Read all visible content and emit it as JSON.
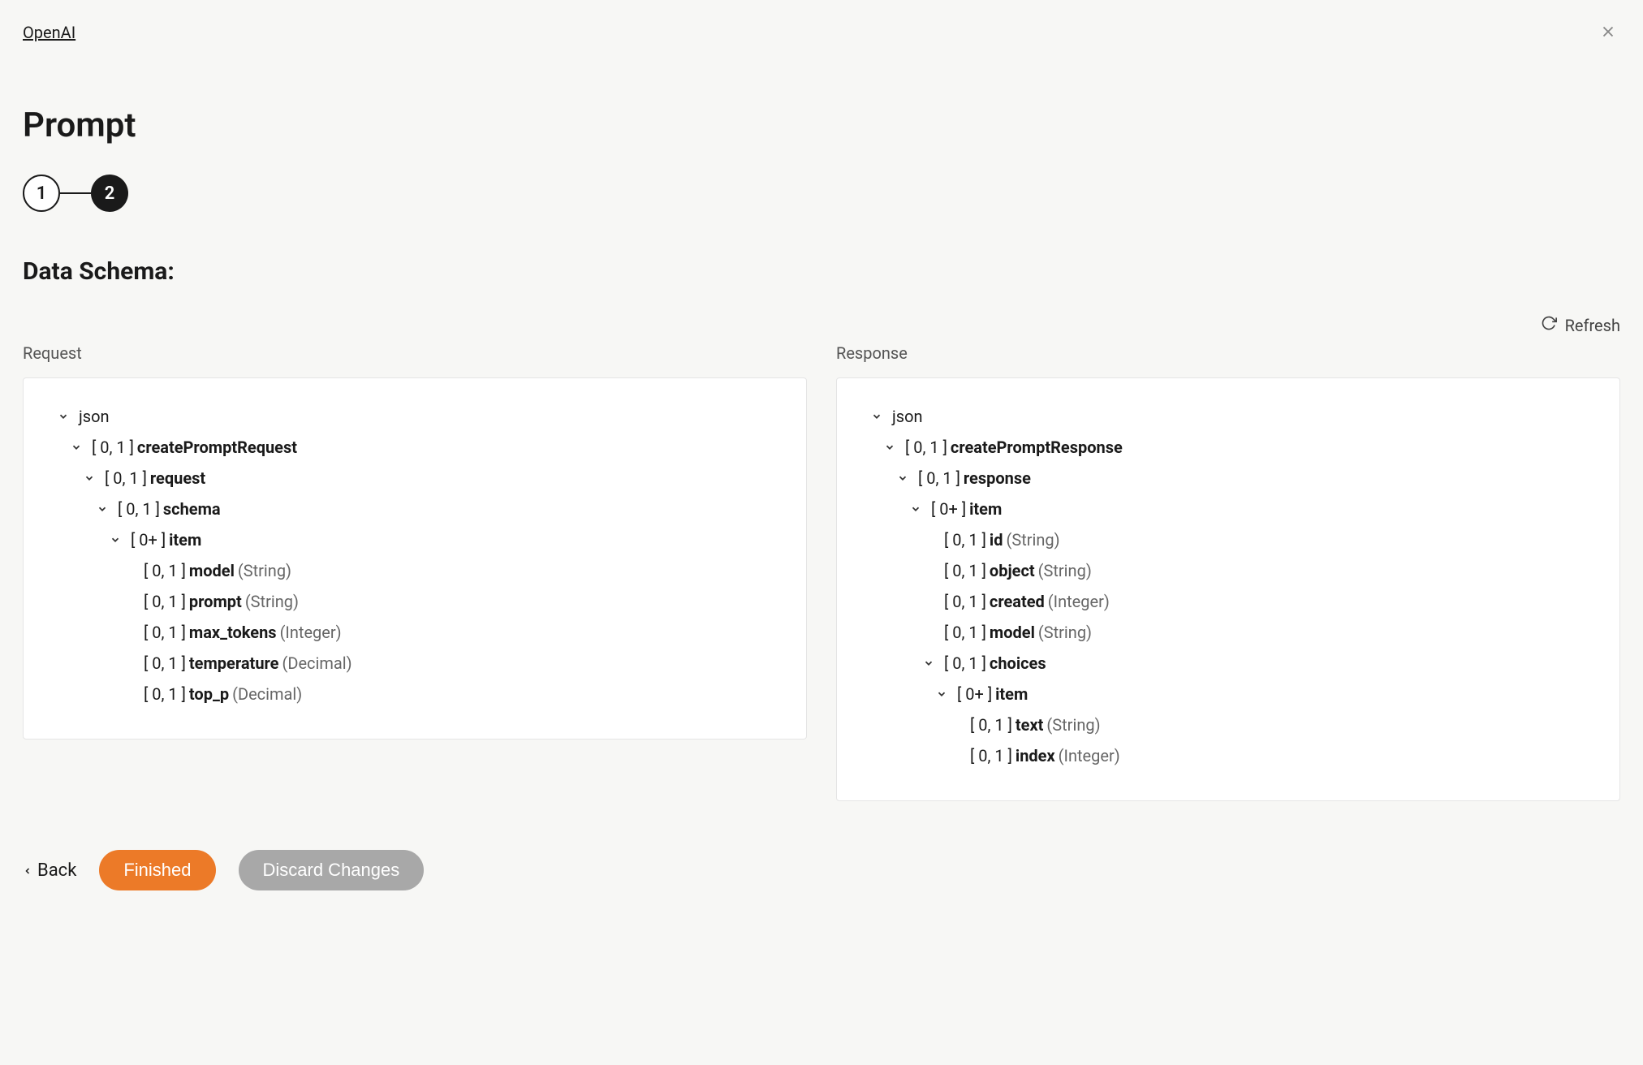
{
  "header": {
    "link": "OpenAI",
    "title": "Prompt"
  },
  "stepper": {
    "step1": "1",
    "step2": "2"
  },
  "schema": {
    "title": "Data Schema:",
    "refresh": "Refresh"
  },
  "columns": {
    "request": {
      "header": "Request",
      "root": "json",
      "nodes": {
        "n0": {
          "card": "[ 0, 1 ] ",
          "name": "createPromptRequest"
        },
        "n1": {
          "card": "[ 0, 1 ] ",
          "name": "request"
        },
        "n2": {
          "card": "[ 0, 1 ] ",
          "name": "schema"
        },
        "n3": {
          "card": "[ 0+ ] ",
          "name": "item"
        },
        "n4": {
          "card": "[ 0, 1 ] ",
          "name": "model",
          "type": " (String)"
        },
        "n5": {
          "card": "[ 0, 1 ] ",
          "name": "prompt",
          "type": " (String)"
        },
        "n6": {
          "card": "[ 0, 1 ] ",
          "name": "max_tokens",
          "type": " (Integer)"
        },
        "n7": {
          "card": "[ 0, 1 ] ",
          "name": "temperature",
          "type": " (Decimal)"
        },
        "n8": {
          "card": "[ 0, 1 ] ",
          "name": "top_p",
          "type": " (Decimal)"
        }
      }
    },
    "response": {
      "header": "Response",
      "root": "json",
      "nodes": {
        "n0": {
          "card": "[ 0, 1 ] ",
          "name": "createPromptResponse"
        },
        "n1": {
          "card": "[ 0, 1 ] ",
          "name": "response"
        },
        "n2": {
          "card": "[ 0+ ] ",
          "name": "item"
        },
        "n3": {
          "card": "[ 0, 1 ] ",
          "name": "id",
          "type": " (String)"
        },
        "n4": {
          "card": "[ 0, 1 ] ",
          "name": "object",
          "type": " (String)"
        },
        "n5": {
          "card": "[ 0, 1 ] ",
          "name": "created",
          "type": " (Integer)"
        },
        "n6": {
          "card": "[ 0, 1 ] ",
          "name": "model",
          "type": " (String)"
        },
        "n7": {
          "card": "[ 0, 1 ] ",
          "name": "choices"
        },
        "n8": {
          "card": "[ 0+ ] ",
          "name": "item"
        },
        "n9": {
          "card": "[ 0, 1 ] ",
          "name": "text",
          "type": " (String)"
        },
        "n10": {
          "card": "[ 0, 1 ] ",
          "name": "index",
          "type": " (Integer)"
        }
      }
    }
  },
  "footer": {
    "back": "Back",
    "finished": "Finished",
    "discard": "Discard Changes"
  }
}
